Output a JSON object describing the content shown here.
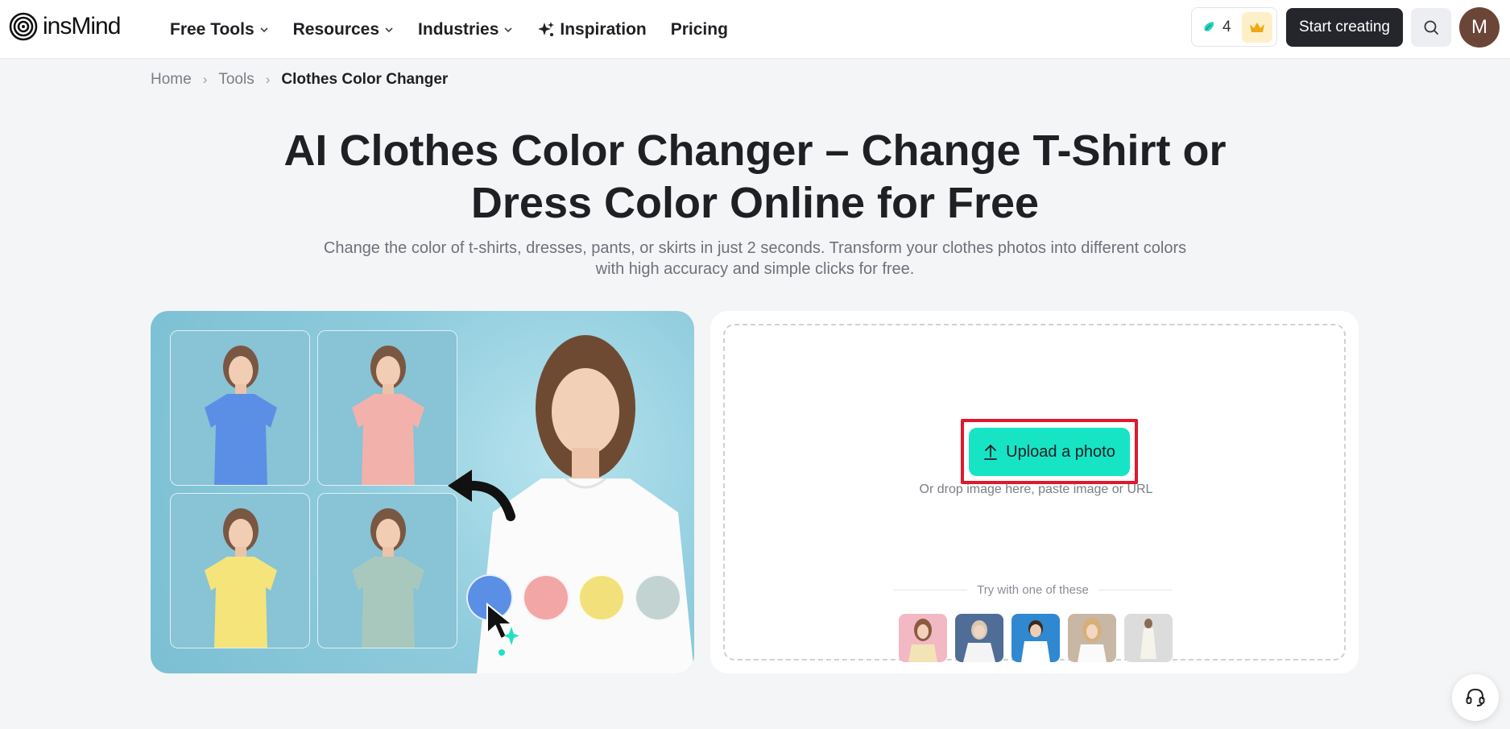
{
  "brand": {
    "name": "insMind",
    "logo_icon": "spiral-logo-icon"
  },
  "nav": {
    "items": [
      {
        "label": "Free Tools",
        "has_dropdown": true
      },
      {
        "label": "Resources",
        "has_dropdown": true
      },
      {
        "label": "Industries",
        "has_dropdown": true
      },
      {
        "label": "Inspiration",
        "icon": "sparkles-icon"
      },
      {
        "label": "Pricing"
      }
    ],
    "credits": {
      "count": "4",
      "icon": "credit-drop-icon",
      "badge_icon": "crown-icon"
    },
    "start_label": "Start creating",
    "search_icon": "search-icon",
    "avatar_letter": "M"
  },
  "breadcrumb": {
    "home": "Home",
    "tools": "Tools",
    "current": "Clothes Color Changer"
  },
  "hero": {
    "title_line1": "AI Clothes Color Changer – Change T-Shirt or",
    "title_line2": "Dress Color Online for Free",
    "subtitle_line1": "Change the color of t-shirts, dresses, pants, or skirts in just 2 seconds. Transform your clothes photos into different colors",
    "subtitle_line2": "with high accuracy and simple clicks for free."
  },
  "showcase": {
    "tile_colors": [
      "#5b8fe6",
      "#f3b1ac",
      "#f5e47a",
      "#a9c8bd"
    ],
    "swatch_colors": [
      "#5b8fe6",
      "#f2a6a6",
      "#f2e07a",
      "#c2d3d1"
    ]
  },
  "upload": {
    "button_label": "Upload a photo",
    "hint": "Or drop image here, paste image or URL",
    "try_label": "Try with one of these"
  },
  "support_icon": "headset-icon"
}
